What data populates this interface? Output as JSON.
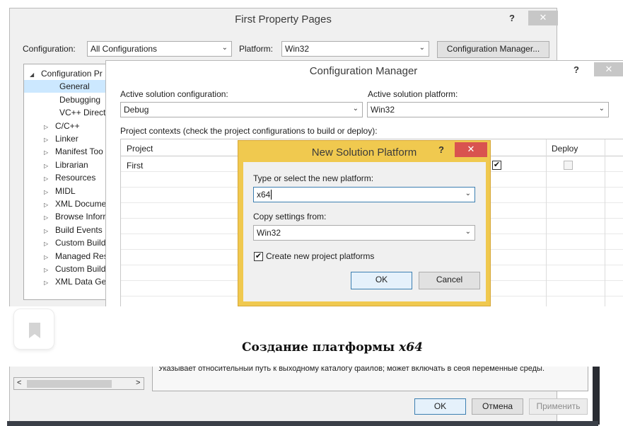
{
  "property_pages": {
    "title": "First Property Pages",
    "help": "?",
    "close": "✕",
    "configuration_label": "Configuration:",
    "configuration_value": "All Configurations",
    "platform_label": "Platform:",
    "platform_value": "Win32",
    "config_manager_button": "Configuration Manager...",
    "tree": [
      {
        "label": "Configuration Pr",
        "glyph": "◢",
        "indent": 0
      },
      {
        "label": "General",
        "glyph": "",
        "indent": 1,
        "selected": true
      },
      {
        "label": "Debugging",
        "glyph": "",
        "indent": 1
      },
      {
        "label": "VC++ Directo",
        "glyph": "",
        "indent": 1
      },
      {
        "label": "C/C++",
        "glyph": "▷",
        "indent": 1
      },
      {
        "label": "Linker",
        "glyph": "▷",
        "indent": 1
      },
      {
        "label": "Manifest Too",
        "glyph": "▷",
        "indent": 1
      },
      {
        "label": "Librarian",
        "glyph": "▷",
        "indent": 1
      },
      {
        "label": "Resources",
        "glyph": "▷",
        "indent": 1
      },
      {
        "label": "MIDL",
        "glyph": "▷",
        "indent": 1
      },
      {
        "label": "XML Docume",
        "glyph": "▷",
        "indent": 1
      },
      {
        "label": "Browse Inforr",
        "glyph": "▷",
        "indent": 1
      },
      {
        "label": "Build Events",
        "glyph": "▷",
        "indent": 1
      },
      {
        "label": "Custom Build",
        "glyph": "▷",
        "indent": 1
      },
      {
        "label": "Managed Res",
        "glyph": "▷",
        "indent": 1
      },
      {
        "label": "Custom Build",
        "glyph": "▷",
        "indent": 1
      },
      {
        "label": "XML Data Ger",
        "glyph": "▷",
        "indent": 1
      }
    ],
    "scroll_left": "<",
    "scroll_right": ">",
    "description": "Указывает относительный путь к выходному каталогу файлов; может включать в себя  переменные среды.",
    "ok_button": "OK",
    "cancel_button": "Отмена",
    "apply_button": "Применить"
  },
  "config_manager": {
    "title": "Configuration Manager",
    "help": "?",
    "close": "✕",
    "active_config_label": "Active solution configuration:",
    "active_config_value": "Debug",
    "active_platform_label": "Active solution platform:",
    "active_platform_value": "Win32",
    "contexts_label": "Project contexts (check the project configurations to build or deploy):",
    "columns": {
      "project": "Project",
      "deploy": "Deploy"
    },
    "rows": [
      {
        "project": "First",
        "build": true,
        "deploy": false
      }
    ]
  },
  "new_platform": {
    "title": "New Solution Platform",
    "help": "?",
    "close": "✕",
    "type_label": "Type or select the new platform:",
    "type_value": "x64",
    "copy_label": "Copy settings from:",
    "copy_value": "Win32",
    "create_label": "Create new project platforms",
    "create_checked": true,
    "ok_button": "OK",
    "cancel_button": "Cancel"
  },
  "caption": {
    "text": "Создание платформы ",
    "emphasis": "x64"
  },
  "icons": {
    "bookmark": "bookmark-icon",
    "dropdown": "chevron-down-icon",
    "check": "checkmark-icon"
  }
}
